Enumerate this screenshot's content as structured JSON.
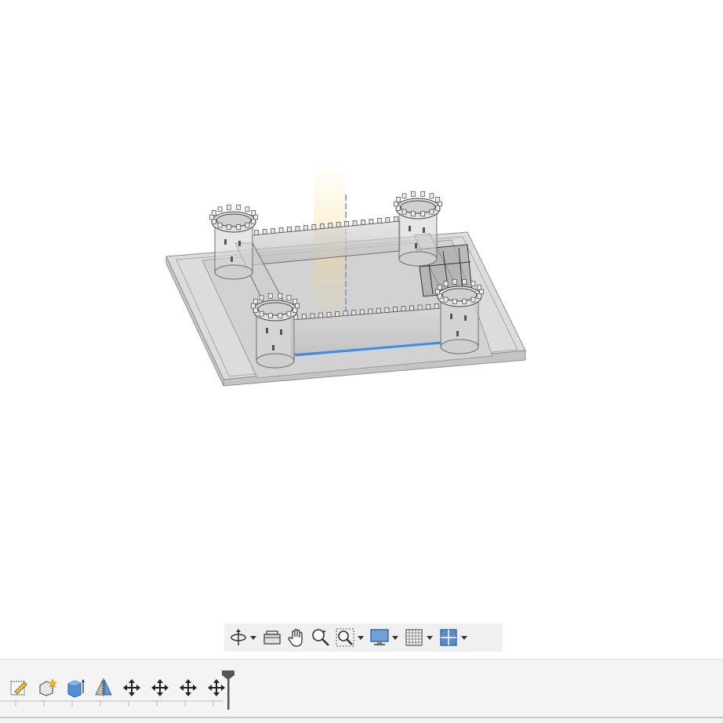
{
  "app": {
    "title": ""
  },
  "viewport": {
    "model_name": "castle-model",
    "selection_color": "#3a8ee6",
    "axis_colors": {
      "vertical": "#8a7fd0",
      "glow": "#f3d98a"
    }
  },
  "nav_toolbar": {
    "items": [
      {
        "icon": "orbit-icon",
        "has_dropdown": true
      },
      {
        "icon": "look-at-icon",
        "has_dropdown": false
      },
      {
        "icon": "pan-hand-icon",
        "has_dropdown": false
      },
      {
        "icon": "zoom-icon",
        "has_dropdown": false
      },
      {
        "icon": "fit-window-icon",
        "has_dropdown": true
      },
      {
        "icon": "display-settings-icon",
        "has_dropdown": true
      },
      {
        "icon": "grid-snaps-icon",
        "has_dropdown": true
      },
      {
        "icon": "viewports-icon",
        "has_dropdown": true
      }
    ]
  },
  "timeline": {
    "features": [
      {
        "icon": "sketch-icon"
      },
      {
        "icon": "form-icon"
      },
      {
        "icon": "extrude-icon"
      },
      {
        "icon": "mirror-icon"
      },
      {
        "icon": "move-icon"
      },
      {
        "icon": "move-icon"
      },
      {
        "icon": "move-icon"
      },
      {
        "icon": "move-icon"
      }
    ],
    "marker_color": "#555555"
  }
}
